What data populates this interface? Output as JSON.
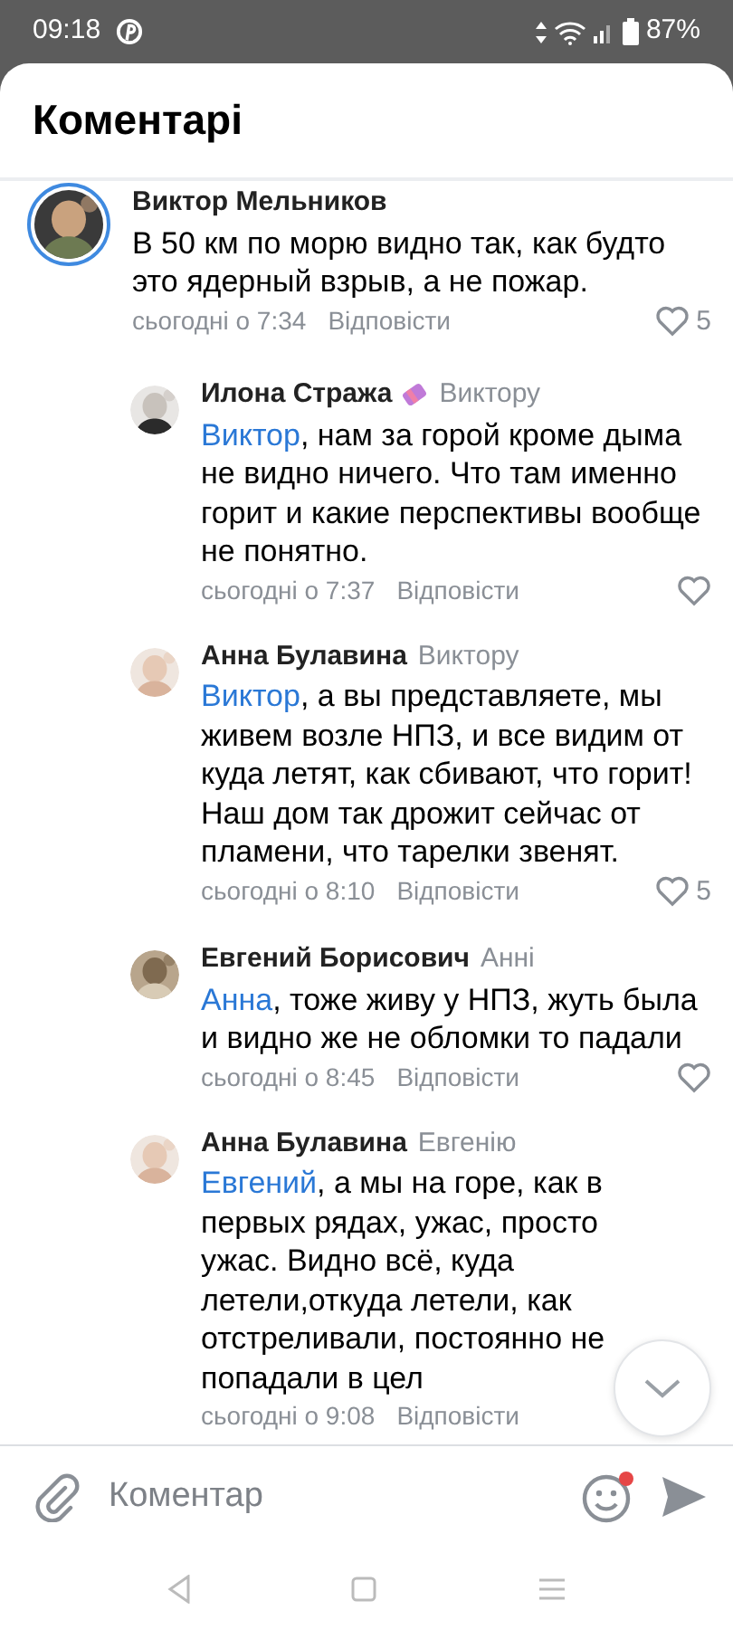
{
  "status_bar": {
    "time": "09:18",
    "battery": "87%"
  },
  "header": {
    "title": "Коментарі"
  },
  "comments": [
    {
      "kind": "comment",
      "author": "Виктор Мельников",
      "badge": false,
      "text": "В 50 км по морю видно так, как будто это ядерный взрыв, а не пожар.",
      "time": "сьогодні о 7:34",
      "reply_label": "Відповісти",
      "likes": "5"
    },
    {
      "kind": "reply",
      "author": "Илона Стража",
      "badge": true,
      "reply_to": "Виктору",
      "mention": "Виктор",
      "text": ", нам за горой кроме дыма не видно ничего. Что там именно горит и какие перспективы вообще не понятно.",
      "time": "сьогодні о 7:37",
      "reply_label": "Відповісти"
    },
    {
      "kind": "reply",
      "author": "Анна Булавина",
      "badge": false,
      "reply_to": "Виктору",
      "mention": "Виктор",
      "text": ", а вы представляете, мы живем возле НПЗ, и все видим от куда летят, как сбивают, что горит! Наш дом так дрожит сейчас от пламени, что тарелки звенят.",
      "time": "сьогодні о 8:10",
      "reply_label": "Відповісти",
      "likes": "5"
    },
    {
      "kind": "reply",
      "author": "Евгений Борисович",
      "badge": false,
      "reply_to": "Анні",
      "mention": "Анна",
      "text": ", тоже живу у НПЗ, жуть была и видно же не обломки то падали",
      "time": "сьогодні о 8:45",
      "reply_label": "Відповісти"
    },
    {
      "kind": "reply",
      "author": "Анна Булавина",
      "badge": false,
      "reply_to": "Евгенію",
      "mention": "Евгений",
      "text": ", а мы на горе, как в первых рядах, ужас, просто ужас. Видно всё, куда летели,откуда летели, как отстреливали, постоянно не попадали в цел",
      "time": "сьогодні о 9:08",
      "reply_label": "Відповісти"
    }
  ],
  "composer": {
    "placeholder": "Коментар",
    "emoji_notification": true
  }
}
